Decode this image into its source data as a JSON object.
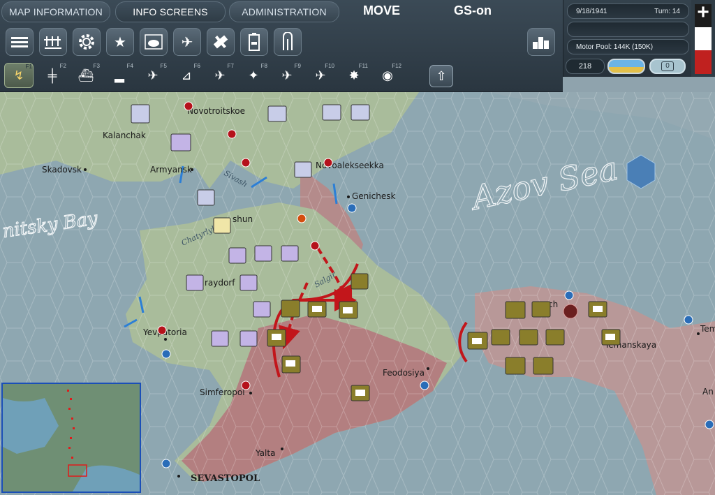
{
  "tabs": {
    "map_information": "MAP INFORMATION",
    "info_screens": "INFO SCREENS",
    "administration": "ADMINISTRATION",
    "mode": "MOVE",
    "gs": "GS-on"
  },
  "toolbar_top": [
    "unit-list-icon",
    "production-icon",
    "settings-gear-icon",
    "star-icon",
    "weather-map-icon",
    "air-ops-icon",
    "satellite-icon",
    "battery-icon",
    "rail-icon"
  ],
  "fkeys": [
    "F1",
    "F2",
    "F3",
    "F4",
    "F5",
    "F6",
    "F7",
    "F8",
    "F9",
    "F10",
    "F11",
    "F12"
  ],
  "info": {
    "date": "9/18/1941",
    "turn": "Turn: 14",
    "motor_pool": "Motor Pool: 144K (150K)",
    "supply": "218",
    "counter": "0"
  },
  "colors": {
    "axis_unit": "#c3b4e6",
    "soviet_unit": "#8a7e2b",
    "arrow": "#c2161b",
    "sea": "#8fa8b3",
    "steppe": "#a9bd9a",
    "mountain": "#b07d7d"
  },
  "map_labels": [
    "Novotroitskoe",
    "Kalanchak",
    "Armyansk",
    "Skadovsk",
    "Novoalekseekka",
    "Genichesk",
    "shun",
    "raydorf",
    "Yevpatoria",
    "Simferopol",
    "Feodosiya",
    "Yalta",
    "SEVASTOPOL",
    "Temanskaya",
    "Tem",
    "An",
    "ch"
  ],
  "sea_labels": {
    "azov": "Azov Sea",
    "karkinitsky": "nitsky Bay"
  },
  "water_labels": [
    "Chatyrlyk",
    "Sivash",
    "Salgir"
  ]
}
